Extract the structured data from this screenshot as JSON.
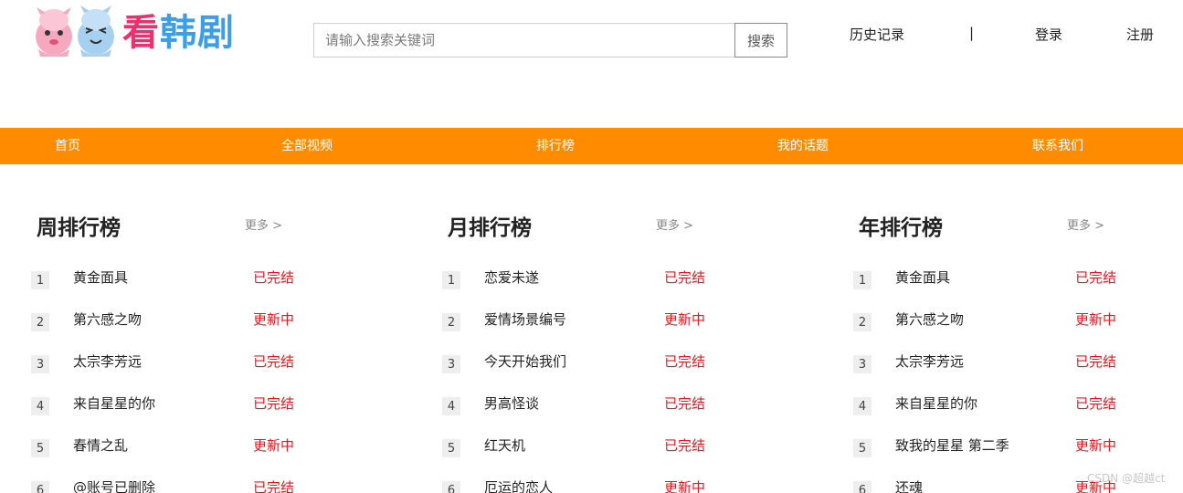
{
  "header": {
    "logo_text": [
      "看",
      "韩",
      "剧"
    ],
    "search": {
      "placeholder": "请输入搜索关键词",
      "button_label": "搜索"
    },
    "links": {
      "history": "历史记录",
      "separator": "|",
      "login": "登录",
      "register": "注册"
    }
  },
  "nav": {
    "items": [
      "首页",
      "全部视频",
      "排行榜",
      "我的话题",
      "联系我们"
    ],
    "bar_color": "#ff8c00"
  },
  "rankings": [
    {
      "title": "周排行榜",
      "more": "更多 >",
      "items": [
        {
          "rank": "1",
          "name": "黄金面具",
          "status": "已完结"
        },
        {
          "rank": "2",
          "name": "第六感之吻",
          "status": "更新中"
        },
        {
          "rank": "3",
          "name": "太宗李芳远",
          "status": "已完结"
        },
        {
          "rank": "4",
          "name": "来自星星的你",
          "status": "已完结"
        },
        {
          "rank": "5",
          "name": "春情之乱",
          "status": "更新中"
        },
        {
          "rank": "6",
          "name": "@账号已删除",
          "status": "已完结"
        }
      ]
    },
    {
      "title": "月排行榜",
      "more": "更多 >",
      "items": [
        {
          "rank": "1",
          "name": "恋爱未遂",
          "status": "已完结"
        },
        {
          "rank": "2",
          "name": "爱情场景编号",
          "status": "更新中"
        },
        {
          "rank": "3",
          "name": "今天开始我们",
          "status": "已完结"
        },
        {
          "rank": "4",
          "name": "男高怪谈",
          "status": "已完结"
        },
        {
          "rank": "5",
          "name": "红天机",
          "status": "已完结"
        },
        {
          "rank": "6",
          "name": "厄运的恋人",
          "status": "更新中"
        }
      ]
    },
    {
      "title": "年排行榜",
      "more": "更多 >",
      "items": [
        {
          "rank": "1",
          "name": "黄金面具",
          "status": "已完结"
        },
        {
          "rank": "2",
          "name": "第六感之吻",
          "status": "更新中"
        },
        {
          "rank": "3",
          "name": "太宗李芳远",
          "status": "已完结"
        },
        {
          "rank": "4",
          "name": "来自星星的你",
          "status": "已完结"
        },
        {
          "rank": "5",
          "name": "致我的星星 第二季",
          "status": "更新中"
        },
        {
          "rank": "6",
          "name": "还魂",
          "status": "更新中"
        }
      ]
    }
  ],
  "colors": {
    "accent": "#ff8c00",
    "status_red": "#e6181f"
  },
  "watermark": "CSDN @超越ct"
}
